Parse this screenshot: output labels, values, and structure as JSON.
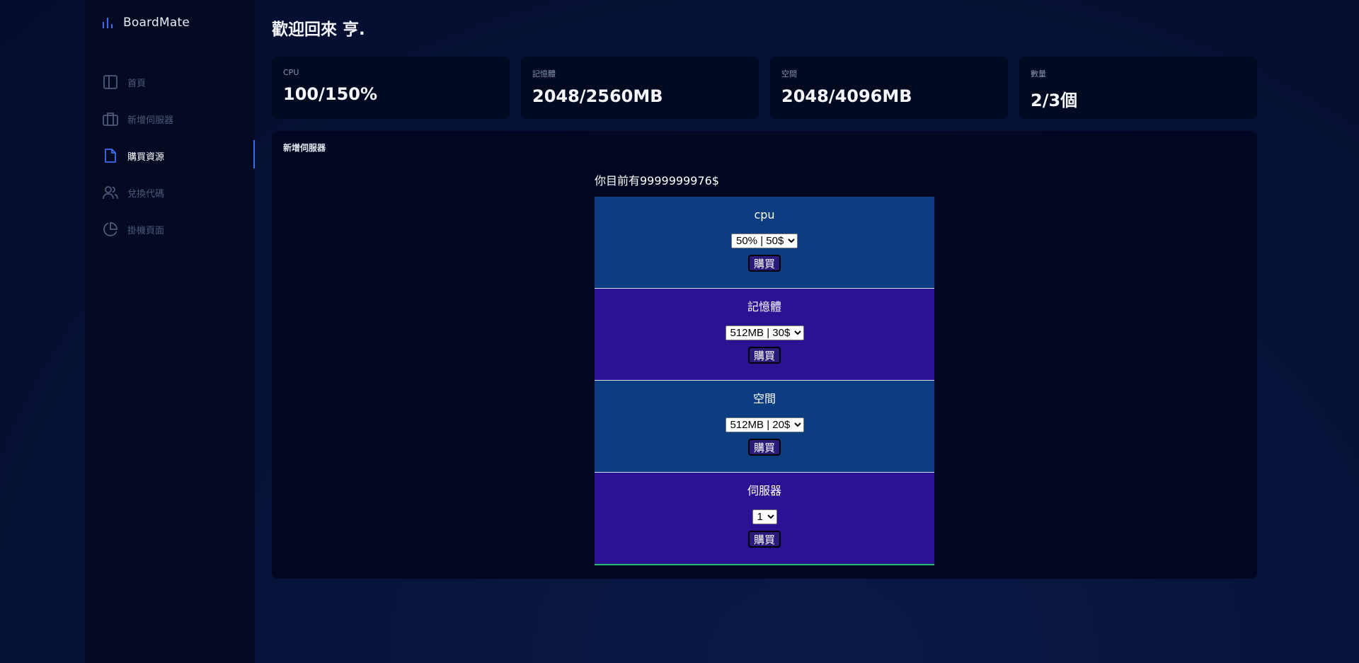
{
  "brand": {
    "name": "BoardMate",
    "icon": "bar-chart-icon"
  },
  "sidebar": {
    "items": [
      {
        "label": "首頁",
        "icon": "layout-icon",
        "active": false
      },
      {
        "label": "新增伺服器",
        "icon": "briefcase-icon",
        "active": false
      },
      {
        "label": "購買資源",
        "icon": "file-icon",
        "active": true
      },
      {
        "label": "兌換代碼",
        "icon": "users-icon",
        "active": false
      },
      {
        "label": "掛機頁面",
        "icon": "pie-chart-icon",
        "active": false
      }
    ]
  },
  "header": {
    "welcome": "歡迎回來 亨."
  },
  "stats": [
    {
      "label": "CPU",
      "value": "100/150%"
    },
    {
      "label": "記憶體",
      "value": "2048/2560MB"
    },
    {
      "label": "空間",
      "value": "2048/4096MB"
    },
    {
      "label": "數量",
      "value": "2/3個"
    }
  ],
  "panel": {
    "title": "新增伺服器",
    "balance": "你目前有9999999976$",
    "shop": [
      {
        "title": "cpu",
        "selected": "50% | 50$",
        "button": "購買",
        "color": "#0b3d80"
      },
      {
        "title": "記憶體",
        "selected": "512MB | 30$",
        "button": "購買",
        "color": "#2b1293"
      },
      {
        "title": "空間",
        "selected": "512MB | 20$",
        "button": "購買",
        "color": "#0b3d80"
      },
      {
        "title": "伺服器",
        "selected": "1",
        "button": "購買",
        "color": "#2b1293"
      }
    ]
  },
  "colors": {
    "accent": "#3b6cf6",
    "sidebar_bg": "#030a22",
    "card_bg": "#020a22",
    "shop_blue": "#0b3d80",
    "shop_purple": "#2b1293"
  }
}
